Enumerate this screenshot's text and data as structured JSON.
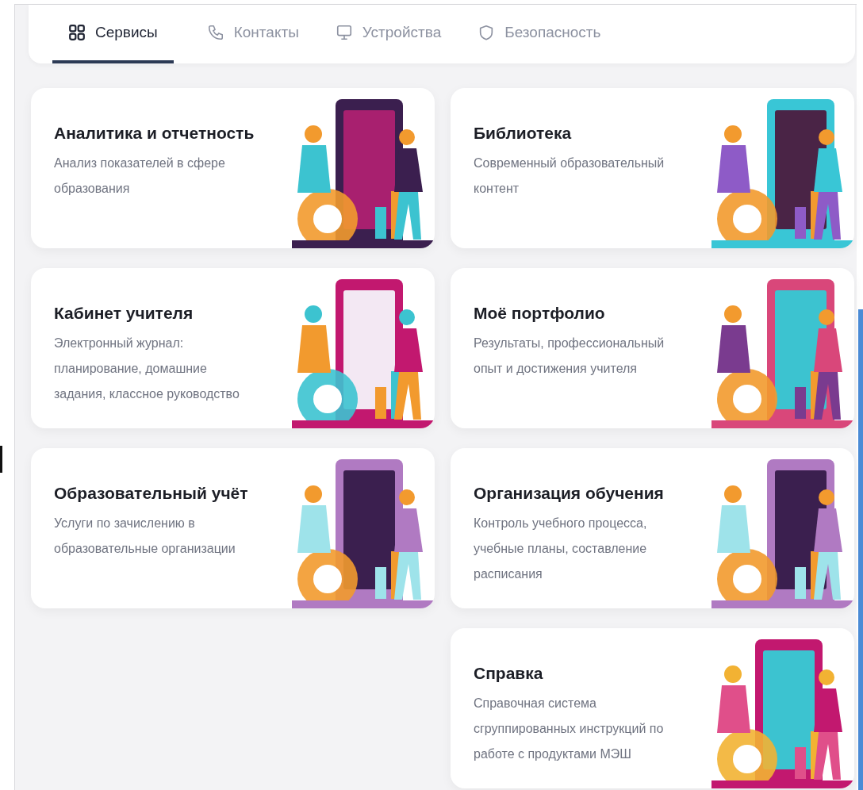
{
  "tabs": [
    {
      "label": "Сервисы",
      "kind": "grid",
      "selected": true
    },
    {
      "label": "Контакты",
      "kind": "phone",
      "selected": false
    },
    {
      "label": "Устройства",
      "kind": "monitor",
      "selected": false
    },
    {
      "label": "Безопасность",
      "kind": "shield",
      "selected": false
    }
  ],
  "cards": [
    {
      "title": "Аналитика и отчетность",
      "description": "Анализ показателей в сфере образования"
    },
    {
      "title": "Библиотека",
      "description": "Современный образовательный контент"
    },
    {
      "title": "Кабинет учителя",
      "description": "Электронный журнал: планирование, домашние задания, классное руководство"
    },
    {
      "title": "Моё портфолио",
      "description": "Результаты, профессиональный опыт и достижения учителя"
    },
    {
      "title": "Образовательный учёт",
      "description": "Услуги по зачислению в образовательные организации"
    },
    {
      "title": "Организация обучения",
      "description": "Контроль учебного процесса, учебные планы, составление расписания"
    },
    {
      "title": "Справка",
      "description": "Справочная система сгруппированных инструкций по работе с продуктами МЭШ"
    }
  ]
}
